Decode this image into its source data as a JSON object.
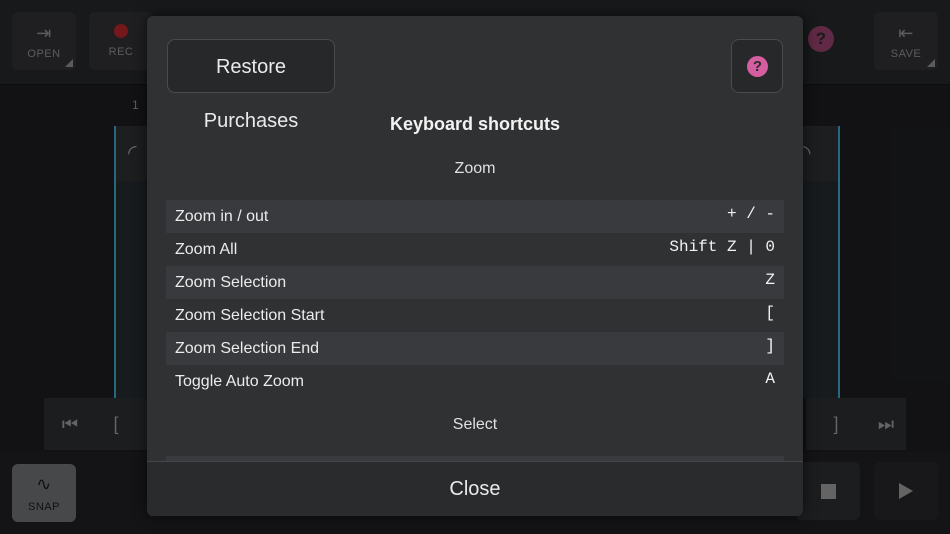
{
  "toolbar": {
    "open_label": "OPEN",
    "rec_label": "REC",
    "save_label": "SAVE"
  },
  "ruler": {
    "marker": "1"
  },
  "transport": {
    "snap_label": "SNAP",
    "bracket_open": "[",
    "bracket_close": "]"
  },
  "icons": {
    "open": "enter-icon",
    "rec": "record-dot-icon",
    "save": "exit-icon",
    "help": "question-mark-icon",
    "snap": "snap-curve-icon",
    "skip_start": "skip-to-start-icon",
    "skip_end": "skip-to-end-icon",
    "stop": "stop-icon",
    "play": "play-icon"
  },
  "colors": {
    "accent_pink": "#d45ea0",
    "record_red": "#b2262c",
    "track_blue": "#3fa2c3"
  },
  "modal": {
    "restore_label": "Restore Purchases",
    "help_glyph": "?",
    "title": "Keyboard shortcuts",
    "sections": [
      {
        "name": "Zoom",
        "shortcuts": [
          {
            "label": "Zoom in / out",
            "keys": "+ / -"
          },
          {
            "label": "Zoom All",
            "keys": "Shift Z | 0"
          },
          {
            "label": "Zoom Selection",
            "keys": "Z"
          },
          {
            "label": "Zoom Selection Start",
            "keys": "["
          },
          {
            "label": "Zoom Selection End",
            "keys": "]"
          },
          {
            "label": "Toggle Auto Zoom",
            "keys": "A"
          }
        ]
      },
      {
        "name": "Select",
        "shortcuts": []
      }
    ],
    "close_label": "Close"
  }
}
